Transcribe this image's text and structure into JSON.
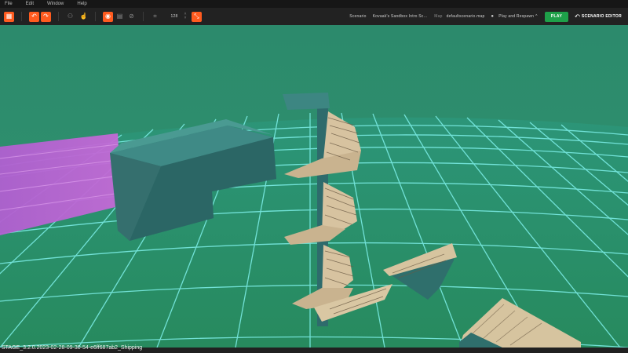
{
  "menu": [
    "File",
    "Edit",
    "Window",
    "Help"
  ],
  "toolbar": {
    "grid_value": "128",
    "scenario_label": "Scenario",
    "scenario_value": "Kovaak's Sandbox Intro Sc...",
    "map_label": "Map",
    "map_value": "defaultscenario.map",
    "play_mode": "Play and Respawn",
    "play_label": "PLAY",
    "editor_label": "Scenario Editor"
  },
  "status": {
    "build": "STAGE_3.2.0.2023-02-28-09-30-54-e6ff687ab2_Shipping"
  },
  "colors": {
    "accent": "#ff5b1f",
    "play_green": "#1ea049",
    "sky": "#2f8c6d",
    "grid": "#6ee8e0"
  }
}
